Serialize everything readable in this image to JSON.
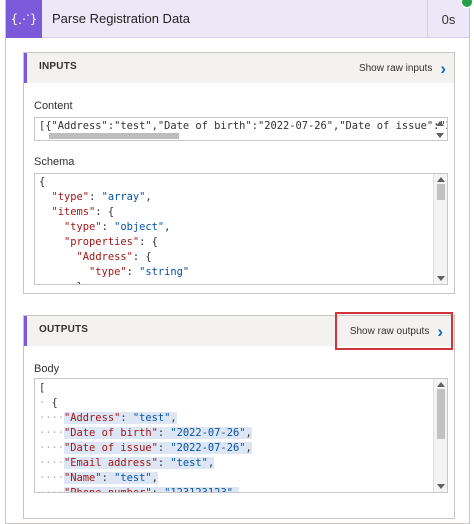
{
  "header": {
    "icon_glyph": "{⋰}",
    "title": "Parse Registration Data",
    "duration": "0s"
  },
  "inputs": {
    "section_title": "INPUTS",
    "raw_label": "Show raw inputs",
    "content_label": "Content",
    "content_value": "[{\"Address\":\"test\",\"Date of birth\":\"2022-07-26\",\"Date of issue\":\"2(",
    "schema_label": "Schema"
  },
  "outputs": {
    "section_title": "OUTPUTS",
    "raw_label": "Show raw outputs",
    "body_label": "Body"
  },
  "colors": {
    "accent": "#7a5ad8",
    "header_bg": "#ece8f8",
    "highlight": "#d13438",
    "link": "#0f6cbd",
    "success": "#24a148"
  },
  "icons": {
    "header": "json-braces-icon",
    "chevron": "chevron-right-icon",
    "status": "success-check-icon"
  }
}
